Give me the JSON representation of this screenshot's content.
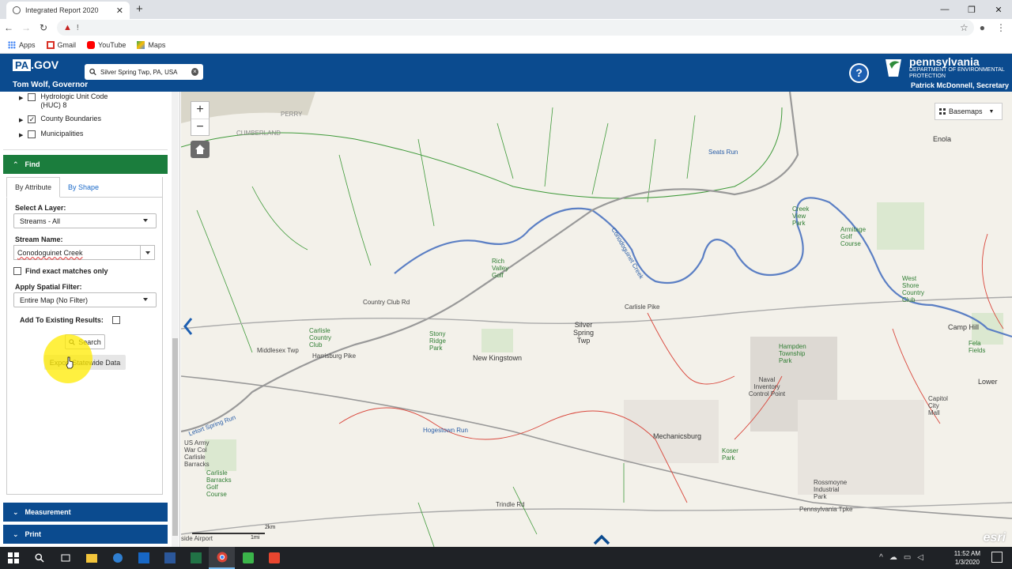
{
  "browser": {
    "tab_title": "Integrated Report 2020",
    "url_prefix": "!",
    "bookmarks": [
      "Apps",
      "Gmail",
      "YouTube",
      "Maps"
    ]
  },
  "header": {
    "pagov": "PA",
    "pagov_suffix": ".GOV",
    "governor": "Tom Wolf, Governor",
    "search_value": "Silver Spring Twp, PA, USA",
    "dep_title": "pennsylvania",
    "dep_line1": "DEPARTMENT OF ENVIRONMENTAL",
    "dep_line2": "PROTECTION",
    "secretary": "Patrick McDonnell, Secretary"
  },
  "layers": [
    {
      "label": "Hydrologic Unit Code (HUC) 8",
      "checked": false
    },
    {
      "label": "County Boundaries",
      "checked": true
    },
    {
      "label": "Municipalities",
      "checked": false
    }
  ],
  "find": {
    "header": "Find",
    "tab_attribute": "By Attribute",
    "tab_shape": "By Shape",
    "layer_label": "Select A Layer:",
    "layer_value": "Streams - All",
    "stream_label": "Stream Name:",
    "stream_value": "Conodoguinet Creek",
    "exact_label": "Find exact matches only",
    "spatial_label": "Apply Spatial Filter:",
    "spatial_value": "Entire Map (No Filter)",
    "add_existing_label": "Add To Existing Results:",
    "search_button": "Search",
    "export_button": "Export Statewide Data"
  },
  "panels": {
    "measurement": "Measurement",
    "print": "Print"
  },
  "map": {
    "basemaps_label": "Basemaps",
    "zoom_in": "+",
    "zoom_out": "−",
    "scale_km": "2km",
    "scale_mi": "1mi",
    "esri": "esri",
    "labels": {
      "silver_spring": "Silver\nSpring\nTwp",
      "new_kingstown": "New Kingstown",
      "mechanicsburg": "Mechanicsburg",
      "camp_hill": "Camp Hill",
      "enola": "Enola",
      "lower": "Lower",
      "middlesex": "Middlesex Twp",
      "carlisle_pike": "Carlisle Pike",
      "harrisburg_pike": "Harrisburg Pike",
      "hogestown_run": "Hogestown Run",
      "trindle_rd": "Trindle Rd",
      "pennsylvania_tpke": "Pennsylvania Tpke",
      "seats_run": "Seats Run",
      "conodoguinet": "Conodoguinet Creek",
      "naval_inventory": "Naval Inventory Control Point",
      "hampden_park": "Hampden Township Park",
      "country_club_rd": "Country Club Rd",
      "rich_valley": "Rich Valley Golf",
      "stony_ridge": "Stony Ridge Park",
      "carlisle_cc": "Carlisle Country Club",
      "west_shore": "West Shore Country Club",
      "armitage": "Armitage Golf Course",
      "creek_view": "Creek View Park",
      "kosher_park": "Koser Park",
      "rossmoyne": "Rossmoyne Industrial Park",
      "letort": "Letort Spring Run",
      "us_army": "US Army War Col Carlisle Barracks",
      "carlisle_golf": "Carlisle Barracks Golf Course",
      "cumberland": "CUMBERLAND",
      "perry": "PERRY",
      "fela_fields": "Fela Fields",
      "capitol_city": "Capitol City Mall",
      "airport": "side Airport"
    }
  },
  "taskbar": {
    "time": "11:52 AM",
    "date": "1/3/2020"
  },
  "colors": {
    "header_blue": "#0b4b8f",
    "find_green": "#1b7d3d",
    "stream_green": "#3f9a3a",
    "river_blue": "#5b7fc4",
    "boundary_red": "#d9473c"
  }
}
